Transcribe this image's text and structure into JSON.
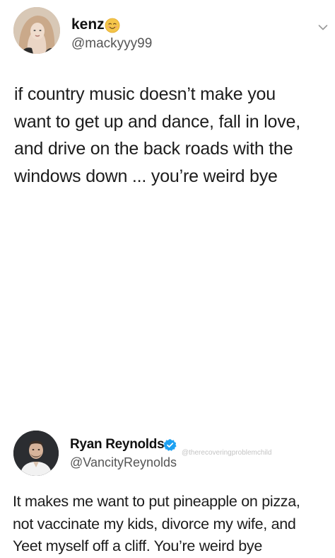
{
  "original_post": {
    "display_name": "kenz",
    "handle": "@mackyyy99",
    "name_emoji_icon": "smiling-face-emoji-icon",
    "menu_icon": "chevron-down-icon",
    "text": "if country music doesn’t make you\nwant to get up and dance, fall in love,\nand drive on the back roads with the\nwindows down ... you’re weird bye"
  },
  "reply_post": {
    "display_name": "Ryan Reynolds",
    "handle": "@VancityReynolds",
    "verified_icon": "verified-badge-icon",
    "verified_color": "#1da1f2",
    "watermark": "@therecoveringproblemchild",
    "text": "It makes me want to put pineapple on pizza,\nnot vaccinate my kids, divorce  my wife, and\nYeet myself off a cliff. You’re weird bye"
  }
}
